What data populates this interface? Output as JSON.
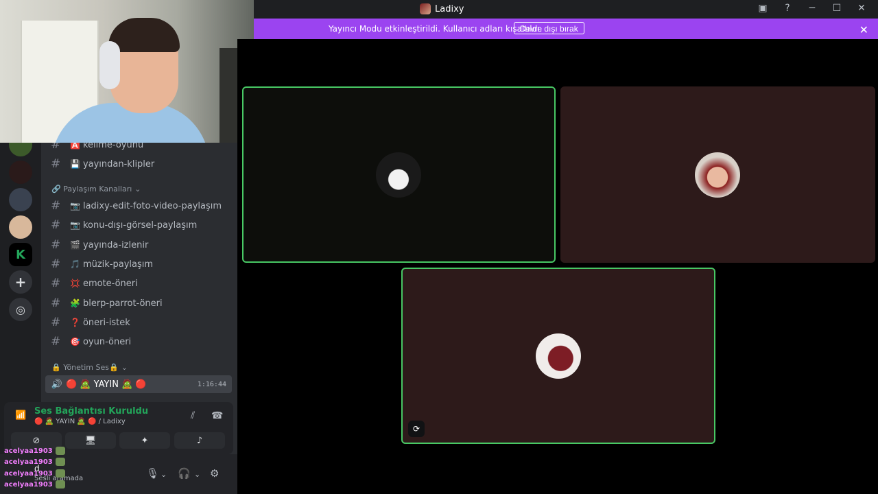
{
  "window": {
    "title": "Ladixy"
  },
  "banner": {
    "message": "Yayıncı Modu etkinleştirildi. Kullanıcı adları kısaltıldı.",
    "button": "Devre dışı bırak"
  },
  "channels": {
    "items_top": [
      {
        "emoji": "🅰️",
        "name": "kelime-oyunu"
      },
      {
        "emoji": "💾",
        "name": "yayından-klipler"
      }
    ],
    "category_share": "🔗 Paylaşım Kanalları",
    "items_share": [
      {
        "emoji": "📷",
        "name": "ladixy-edit-foto-video-paylaşım"
      },
      {
        "emoji": "📷",
        "name": "konu-dışı-görsel-paylaşım"
      },
      {
        "emoji": "🎬",
        "name": "yayında-izlenir"
      },
      {
        "emoji": "🎵",
        "name": "müzik-paylaşım"
      },
      {
        "emoji": "💢",
        "name": "emote-öneri"
      },
      {
        "emoji": "🧩",
        "name": "blerp-parrot-öneri"
      },
      {
        "emoji": "❓",
        "name": "öneri-istek"
      },
      {
        "emoji": "🎯",
        "name": "oyun-öneri"
      }
    ],
    "category_admin": "🔒 Yönetim Ses🔒",
    "voice_channel": {
      "name": "🔴 🧟 YAYIN 🧟 🔴",
      "time": "1:16:44"
    }
  },
  "voice_panel": {
    "status": "Ses Bağlantısı Kuruldu",
    "channel_path": "🔴 🧟 YAYIN 🧟 🔴 / Ladixy"
  },
  "userbar": {
    "status": "Sesli aramada",
    "initial": "d"
  },
  "chat_overlay": [
    "acelyaa1903",
    "acelyaa1903",
    "acelyaa1903",
    "acelyaa1903"
  ],
  "colors": {
    "banner": "#9b44f0",
    "speaking": "#48c864",
    "connected": "#23a55a"
  }
}
